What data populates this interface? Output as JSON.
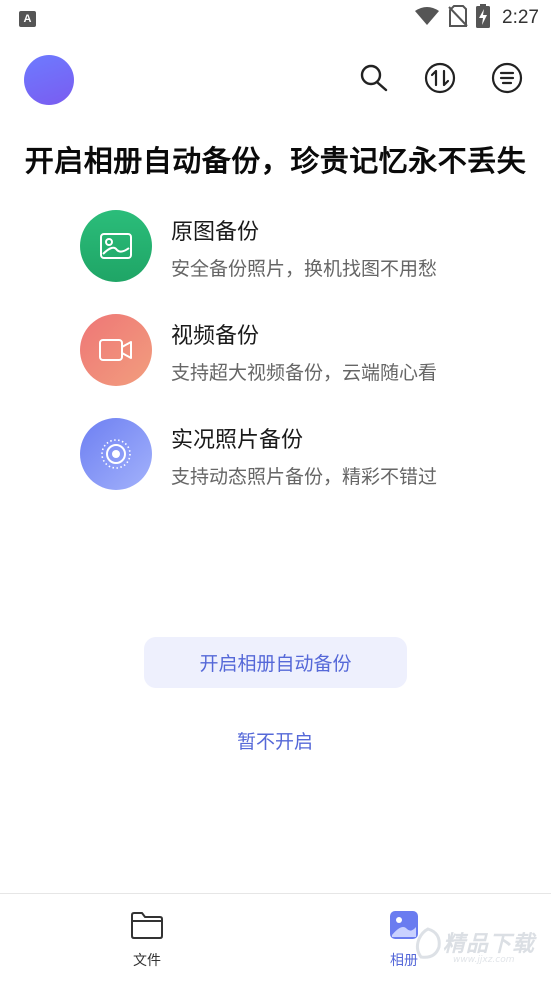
{
  "status_bar": {
    "app_icon_letter": "A",
    "time": "2:27",
    "icons": [
      "wifi-icon",
      "no-sim-icon",
      "battery-charging-icon"
    ]
  },
  "header": {
    "avatar": "avatar",
    "actions": [
      "search-icon",
      "transfer-icon",
      "menu-icon"
    ]
  },
  "headline": "开启相册自动备份，珍贵记忆永不丢失",
  "features": [
    {
      "title": "原图备份",
      "desc": "安全备份照片，换机找图不用愁",
      "icon": "photo-icon",
      "color": "#22b06f"
    },
    {
      "title": "视频备份",
      "desc": "支持超大视频备份，云端随心看",
      "icon": "video-camera-icon",
      "color": "#ef7f72"
    },
    {
      "title": "实况照片备份",
      "desc": "支持动态照片备份，精彩不错过",
      "icon": "live-photo-icon",
      "color": "#7c8cf5"
    }
  ],
  "actions": {
    "primary": "开启相册自动备份",
    "secondary": "暂不开启"
  },
  "bottom_nav": {
    "items": [
      {
        "label": "文件",
        "icon": "folder-icon",
        "active": false
      },
      {
        "label": "相册",
        "icon": "album-icon",
        "active": true
      }
    ]
  },
  "watermark": {
    "text": "精品下载",
    "sub": "www.jjxz.com"
  },
  "colors": {
    "accent": "#5568d8",
    "accent_bg": "#eef0fd"
  }
}
